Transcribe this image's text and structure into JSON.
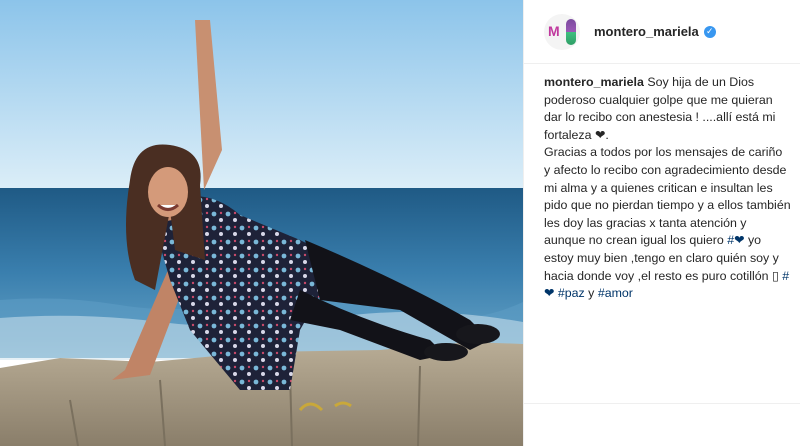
{
  "post": {
    "photo_description": "woman on a stone wall by the ocean"
  },
  "header": {
    "username": "montero_mariela",
    "avatar_letter": "M",
    "verified_glyph": "✓"
  },
  "caption": {
    "username": "montero_mariela",
    "text_1": "Soy hija de un Dios poderoso cualquier golpe que me quieran dar lo recibo con anestesia ! ....allí está mi fortaleza ❤.\nGracias a todos por los mensajes de cariño y afecto lo recibo con agradecimiento desde mi alma y a quienes critican e insultan les pido que no pierdan tiempo y a ellos también les doy las gracias x tanta atención y aunque no crean igual los quiero ",
    "hashtag_heart": "#❤",
    "text_2": " yo estoy muy bien ,tengo en claro quién soy y hacia donde voy ,el resto es puro cotillón ▯ ",
    "hashtag_heart_2": "#❤",
    "hashtag_paz": "#paz",
    "text_3": " y ",
    "hashtag_amor": "#amor"
  },
  "colors": {
    "sky": "#a8d2ee",
    "ocean": "#2f6f9e",
    "wall": "#a89c86",
    "hashtag": "#003569",
    "verified": "#3897f0"
  }
}
